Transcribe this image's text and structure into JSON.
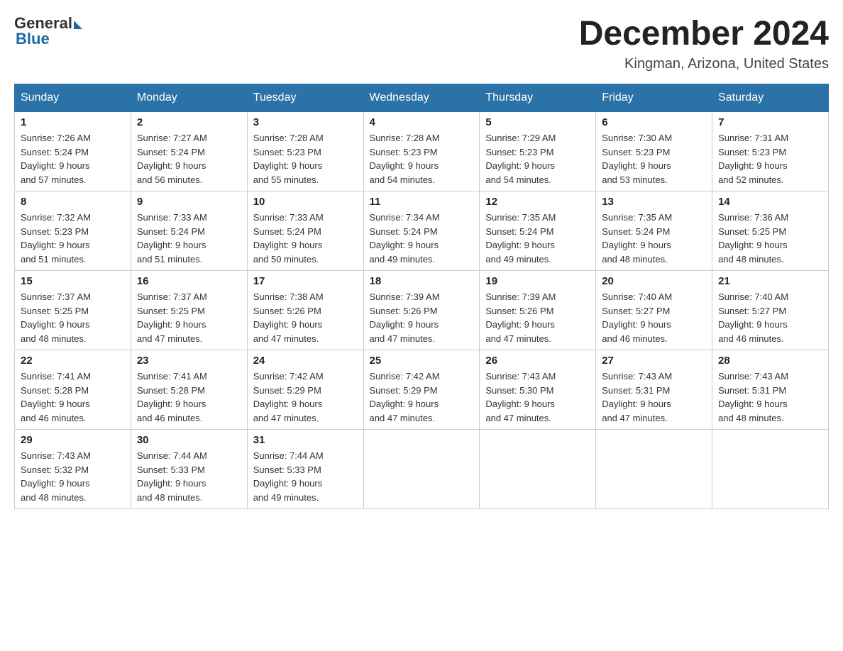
{
  "header": {
    "logo_general": "General",
    "logo_blue": "Blue",
    "month_title": "December 2024",
    "location": "Kingman, Arizona, United States"
  },
  "weekdays": [
    "Sunday",
    "Monday",
    "Tuesday",
    "Wednesday",
    "Thursday",
    "Friday",
    "Saturday"
  ],
  "weeks": [
    [
      {
        "day": "1",
        "sunrise": "Sunrise: 7:26 AM",
        "sunset": "Sunset: 5:24 PM",
        "daylight": "Daylight: 9 hours",
        "daylight2": "and 57 minutes."
      },
      {
        "day": "2",
        "sunrise": "Sunrise: 7:27 AM",
        "sunset": "Sunset: 5:24 PM",
        "daylight": "Daylight: 9 hours",
        "daylight2": "and 56 minutes."
      },
      {
        "day": "3",
        "sunrise": "Sunrise: 7:28 AM",
        "sunset": "Sunset: 5:23 PM",
        "daylight": "Daylight: 9 hours",
        "daylight2": "and 55 minutes."
      },
      {
        "day": "4",
        "sunrise": "Sunrise: 7:28 AM",
        "sunset": "Sunset: 5:23 PM",
        "daylight": "Daylight: 9 hours",
        "daylight2": "and 54 minutes."
      },
      {
        "day": "5",
        "sunrise": "Sunrise: 7:29 AM",
        "sunset": "Sunset: 5:23 PM",
        "daylight": "Daylight: 9 hours",
        "daylight2": "and 54 minutes."
      },
      {
        "day": "6",
        "sunrise": "Sunrise: 7:30 AM",
        "sunset": "Sunset: 5:23 PM",
        "daylight": "Daylight: 9 hours",
        "daylight2": "and 53 minutes."
      },
      {
        "day": "7",
        "sunrise": "Sunrise: 7:31 AM",
        "sunset": "Sunset: 5:23 PM",
        "daylight": "Daylight: 9 hours",
        "daylight2": "and 52 minutes."
      }
    ],
    [
      {
        "day": "8",
        "sunrise": "Sunrise: 7:32 AM",
        "sunset": "Sunset: 5:23 PM",
        "daylight": "Daylight: 9 hours",
        "daylight2": "and 51 minutes."
      },
      {
        "day": "9",
        "sunrise": "Sunrise: 7:33 AM",
        "sunset": "Sunset: 5:24 PM",
        "daylight": "Daylight: 9 hours",
        "daylight2": "and 51 minutes."
      },
      {
        "day": "10",
        "sunrise": "Sunrise: 7:33 AM",
        "sunset": "Sunset: 5:24 PM",
        "daylight": "Daylight: 9 hours",
        "daylight2": "and 50 minutes."
      },
      {
        "day": "11",
        "sunrise": "Sunrise: 7:34 AM",
        "sunset": "Sunset: 5:24 PM",
        "daylight": "Daylight: 9 hours",
        "daylight2": "and 49 minutes."
      },
      {
        "day": "12",
        "sunrise": "Sunrise: 7:35 AM",
        "sunset": "Sunset: 5:24 PM",
        "daylight": "Daylight: 9 hours",
        "daylight2": "and 49 minutes."
      },
      {
        "day": "13",
        "sunrise": "Sunrise: 7:35 AM",
        "sunset": "Sunset: 5:24 PM",
        "daylight": "Daylight: 9 hours",
        "daylight2": "and 48 minutes."
      },
      {
        "day": "14",
        "sunrise": "Sunrise: 7:36 AM",
        "sunset": "Sunset: 5:25 PM",
        "daylight": "Daylight: 9 hours",
        "daylight2": "and 48 minutes."
      }
    ],
    [
      {
        "day": "15",
        "sunrise": "Sunrise: 7:37 AM",
        "sunset": "Sunset: 5:25 PM",
        "daylight": "Daylight: 9 hours",
        "daylight2": "and 48 minutes."
      },
      {
        "day": "16",
        "sunrise": "Sunrise: 7:37 AM",
        "sunset": "Sunset: 5:25 PM",
        "daylight": "Daylight: 9 hours",
        "daylight2": "and 47 minutes."
      },
      {
        "day": "17",
        "sunrise": "Sunrise: 7:38 AM",
        "sunset": "Sunset: 5:26 PM",
        "daylight": "Daylight: 9 hours",
        "daylight2": "and 47 minutes."
      },
      {
        "day": "18",
        "sunrise": "Sunrise: 7:39 AM",
        "sunset": "Sunset: 5:26 PM",
        "daylight": "Daylight: 9 hours",
        "daylight2": "and 47 minutes."
      },
      {
        "day": "19",
        "sunrise": "Sunrise: 7:39 AM",
        "sunset": "Sunset: 5:26 PM",
        "daylight": "Daylight: 9 hours",
        "daylight2": "and 47 minutes."
      },
      {
        "day": "20",
        "sunrise": "Sunrise: 7:40 AM",
        "sunset": "Sunset: 5:27 PM",
        "daylight": "Daylight: 9 hours",
        "daylight2": "and 46 minutes."
      },
      {
        "day": "21",
        "sunrise": "Sunrise: 7:40 AM",
        "sunset": "Sunset: 5:27 PM",
        "daylight": "Daylight: 9 hours",
        "daylight2": "and 46 minutes."
      }
    ],
    [
      {
        "day": "22",
        "sunrise": "Sunrise: 7:41 AM",
        "sunset": "Sunset: 5:28 PM",
        "daylight": "Daylight: 9 hours",
        "daylight2": "and 46 minutes."
      },
      {
        "day": "23",
        "sunrise": "Sunrise: 7:41 AM",
        "sunset": "Sunset: 5:28 PM",
        "daylight": "Daylight: 9 hours",
        "daylight2": "and 46 minutes."
      },
      {
        "day": "24",
        "sunrise": "Sunrise: 7:42 AM",
        "sunset": "Sunset: 5:29 PM",
        "daylight": "Daylight: 9 hours",
        "daylight2": "and 47 minutes."
      },
      {
        "day": "25",
        "sunrise": "Sunrise: 7:42 AM",
        "sunset": "Sunset: 5:29 PM",
        "daylight": "Daylight: 9 hours",
        "daylight2": "and 47 minutes."
      },
      {
        "day": "26",
        "sunrise": "Sunrise: 7:43 AM",
        "sunset": "Sunset: 5:30 PM",
        "daylight": "Daylight: 9 hours",
        "daylight2": "and 47 minutes."
      },
      {
        "day": "27",
        "sunrise": "Sunrise: 7:43 AM",
        "sunset": "Sunset: 5:31 PM",
        "daylight": "Daylight: 9 hours",
        "daylight2": "and 47 minutes."
      },
      {
        "day": "28",
        "sunrise": "Sunrise: 7:43 AM",
        "sunset": "Sunset: 5:31 PM",
        "daylight": "Daylight: 9 hours",
        "daylight2": "and 48 minutes."
      }
    ],
    [
      {
        "day": "29",
        "sunrise": "Sunrise: 7:43 AM",
        "sunset": "Sunset: 5:32 PM",
        "daylight": "Daylight: 9 hours",
        "daylight2": "and 48 minutes."
      },
      {
        "day": "30",
        "sunrise": "Sunrise: 7:44 AM",
        "sunset": "Sunset: 5:33 PM",
        "daylight": "Daylight: 9 hours",
        "daylight2": "and 48 minutes."
      },
      {
        "day": "31",
        "sunrise": "Sunrise: 7:44 AM",
        "sunset": "Sunset: 5:33 PM",
        "daylight": "Daylight: 9 hours",
        "daylight2": "and 49 minutes."
      },
      null,
      null,
      null,
      null
    ]
  ]
}
